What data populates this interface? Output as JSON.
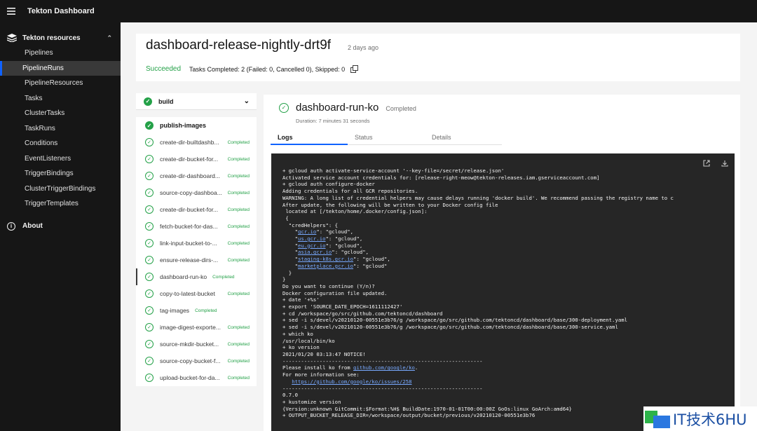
{
  "app": {
    "title": "Tekton Dashboard"
  },
  "sidebar": {
    "group_label": "Tekton resources",
    "items": [
      {
        "label": "Pipelines",
        "active": false
      },
      {
        "label": "PipelineRuns",
        "active": true
      },
      {
        "label": "PipelineResources",
        "active": false
      },
      {
        "label": "Tasks",
        "active": false
      },
      {
        "label": "ClusterTasks",
        "active": false
      },
      {
        "label": "TaskRuns",
        "active": false
      },
      {
        "label": "Conditions",
        "active": false
      },
      {
        "label": "EventListeners",
        "active": false
      },
      {
        "label": "TriggerBindings",
        "active": false
      },
      {
        "label": "ClusterTriggerBindings",
        "active": false
      },
      {
        "label": "TriggerTemplates",
        "active": false
      }
    ],
    "about_label": "About"
  },
  "run": {
    "name": "dashboard-release-nightly-drt9f",
    "age": "2 days ago",
    "status": "Succeeded",
    "tasks_summary": "Tasks Completed: 2 (Failed: 0, Cancelled 0), Skipped: 0"
  },
  "tasks": {
    "build": {
      "label": "build"
    },
    "publish": {
      "label": "publish-images"
    },
    "steps": [
      {
        "label": "create-dir-builtdashb...",
        "status": "Completed"
      },
      {
        "label": "create-dir-bucket-for...",
        "status": "Completed"
      },
      {
        "label": "create-dir-dashboard...",
        "status": "Completed"
      },
      {
        "label": "source-copy-dashboa...",
        "status": "Completed"
      },
      {
        "label": "create-dir-bucket-for...",
        "status": "Completed"
      },
      {
        "label": "fetch-bucket-for-das...",
        "status": "Completed"
      },
      {
        "label": "link-input-bucket-to-...",
        "status": "Completed"
      },
      {
        "label": "ensure-release-dirs-...",
        "status": "Completed"
      },
      {
        "label": "dashboard-run-ko",
        "status": "Completed",
        "selected": true
      },
      {
        "label": "copy-to-latest-bucket",
        "status": "Completed"
      },
      {
        "label": "tag-images",
        "status": "Completed"
      },
      {
        "label": "image-digest-exporte...",
        "status": "Completed"
      },
      {
        "label": "source-mkdir-bucket...",
        "status": "Completed"
      },
      {
        "label": "source-copy-bucket-f...",
        "status": "Completed"
      },
      {
        "label": "upload-bucket-for-da...",
        "status": "Completed"
      }
    ]
  },
  "step": {
    "name": "dashboard-run-ko",
    "status": "Completed",
    "duration": "Duration: 7 minutes 31 seconds",
    "tabs": [
      "Logs",
      "Status",
      "Details"
    ]
  },
  "log": {
    "lines": [
      "+ gcloud auth activate-service-account '--key-file=/secret/release.json'",
      "Activated service account credentials for: [release-right-meow@tekton-releases.iam.gserviceaccount.com]",
      "+ gcloud auth configure-docker",
      "Adding credentials for all GCR repositories.",
      "WARNING: A long list of credential helpers may cause delays running 'docker build'. We recommend passing the registry name to c",
      "After update, the following will be written to your Docker config file",
      " located at [/tekton/home/.docker/config.json]:",
      " {",
      "  \"credHelpers\": {",
      "    \"gcr.io\": \"gcloud\",",
      "    \"us.gcr.io\": \"gcloud\",",
      "    \"eu.gcr.io\": \"gcloud\",",
      "    \"asia.gcr.io\": \"gcloud\",",
      "    \"staging-k8s.gcr.io\": \"gcloud\",",
      "    \"marketplace.gcr.io\": \"gcloud\"",
      "  }",
      "}",
      "",
      "Do you want to continue (Y/n)?",
      "Docker configuration file updated.",
      "+ date '+%s'",
      "+ export 'SOURCE_DATE_EPOCH=1611112427'",
      "+ cd /workspace/go/src/github.com/tektoncd/dashboard",
      "+ sed -i s/devel/v20210120-00551e3b76/g /workspace/go/src/github.com/tektoncd/dashboard/base/300-deployment.yaml",
      "+ sed -i s/devel/v20210120-00551e3b76/g /workspace/go/src/github.com/tektoncd/dashboard/base/300-service.yaml",
      "+ which ko",
      "/usr/local/bin/ko",
      "+ ko version",
      "2021/01/20 03:13:47 NOTICE!",
      "-----------------------------------------------------------------",
      "Please install ko from github.com/google/ko.",
      "",
      "For more information see:",
      "   https://github.com/google/ko/issues/258",
      "-----------------------------------------------------------------",
      "0.7.0",
      "+ kustomize version",
      "{Version:unknown GitCommit:$Format:%H$ BuildDate:1970-01-01T00:00:00Z GoOs:linux GoArch:amd64}",
      "+ OUTPUT_BUCKET_RELEASE_DIR=/workspace/output/bucket/previous/v20210120-00551e3b76"
    ]
  },
  "watermark": {
    "text": "IT技术6HU"
  },
  "icons": {
    "menu": "hamburger-menu-icon",
    "resources": "tekton-resources-icon",
    "about": "info-icon",
    "copy": "copy-icon",
    "launch": "launch-icon",
    "download": "download-icon"
  }
}
